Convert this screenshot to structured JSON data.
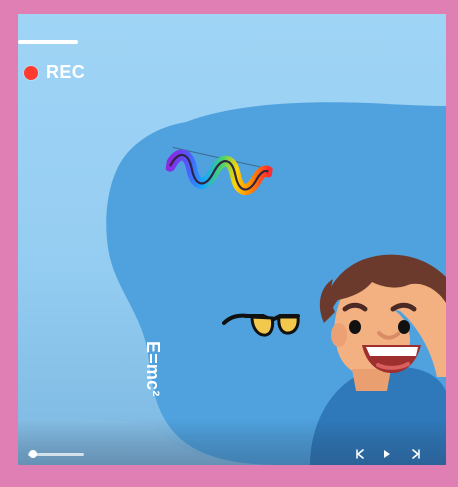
{
  "overlay": {
    "recording_label": "REC",
    "formula_label": "E=mc²"
  },
  "icons": {
    "record_dot": "record-dot-icon",
    "spectrum_wave": "spectrum-wave-icon",
    "glasses": "glasses-icon",
    "character": "boy-character-icon",
    "left_control": "left-control-icon",
    "play_control": "play-icon",
    "right_control": "right-control-icon"
  },
  "colors": {
    "frame_pink": "#e07fb3",
    "sky_blue": "#9fd4f5",
    "blob_blue": "#4fa2de",
    "rec_red": "#ff3b2f"
  }
}
